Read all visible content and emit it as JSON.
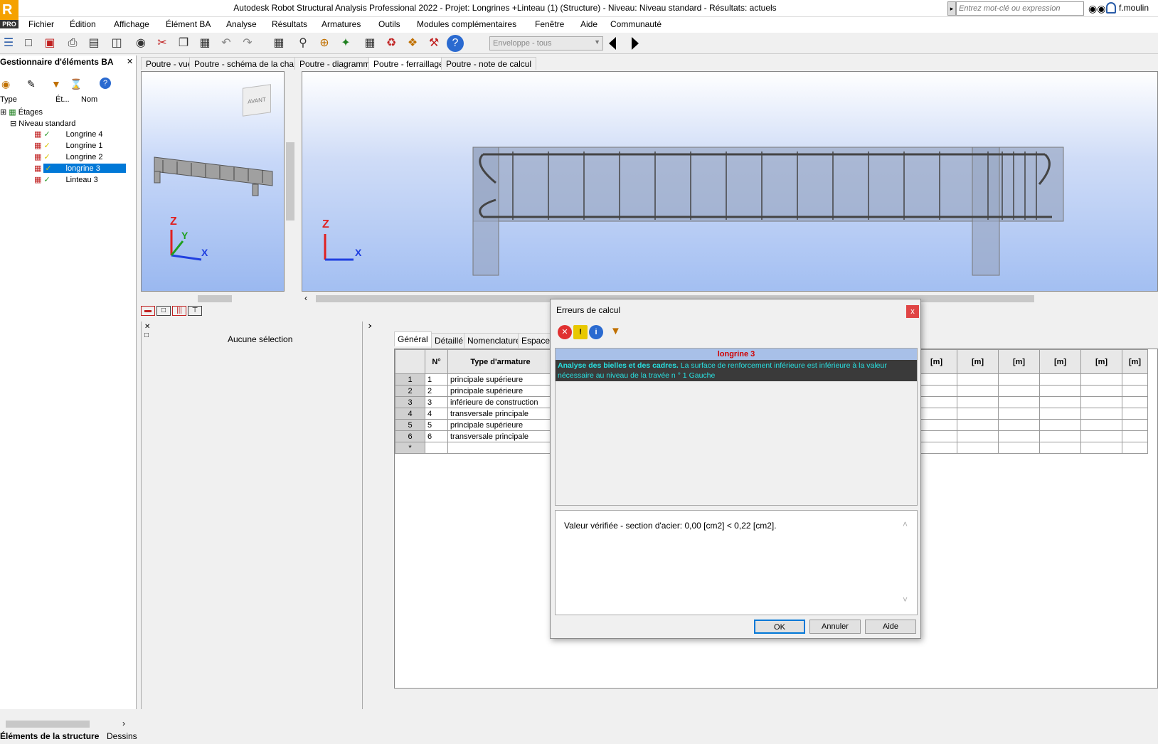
{
  "app": {
    "title": "Autodesk Robot Structural Analysis Professional 2022 - Projet: Longrines +Linteau  (1) (Structure) - Niveau: Niveau standard - Résultats: actuels",
    "logo_letter": "R",
    "logo_sub": "PRO",
    "search_placeholder": "Entrez mot-clé ou expression",
    "user": "f.moulin"
  },
  "menu": [
    "Fichier",
    "Édition",
    "Affichage",
    "Élément BA",
    "Analyse",
    "Résultats",
    "Armatures",
    "Outils",
    "Modules complémentaires",
    "Fenêtre",
    "Aide",
    "Communauté"
  ],
  "toolbar": {
    "envelope_value": "Enveloppe - tous"
  },
  "left_panel": {
    "title": "Gestionnaire d'éléments BA",
    "col_type": "Type",
    "col_state": "Ét...",
    "col_name": "Nom",
    "tree": {
      "root": "Étages",
      "level": "Niveau standard",
      "items": [
        {
          "name": "Longrine 4",
          "status": "ok"
        },
        {
          "name": "Longrine 1",
          "status": "warn"
        },
        {
          "name": "Longrine 2",
          "status": "warn"
        },
        {
          "name": "longrine 3",
          "status": "warn",
          "selected": true
        },
        {
          "name": "Linteau 3",
          "status": "ok"
        }
      ]
    },
    "bottom_tabs": [
      "Éléments de la structure",
      "Dessins"
    ]
  },
  "view_tabs": [
    "Poutre - vue",
    "Poutre - schéma de la charge",
    "Poutre - diagrammes",
    "Poutre - ferraillage",
    "Poutre - note de calcul"
  ],
  "view_tabs_active": 3,
  "view3d": {
    "cube_label": "AVANT",
    "axis_x": "X",
    "axis_y": "Y",
    "axis_z": "Z"
  },
  "selection_panel": {
    "label": "Aucune sélection"
  },
  "grid": {
    "tabs": [
      "Général",
      "Détaillé",
      "Nomenclature",
      "Espacement"
    ],
    "headers": [
      "N°",
      "Type d'armature"
    ],
    "unit_headers": [
      "[m]",
      "[m]",
      "[m]",
      "[m]",
      "[m]",
      "[m]"
    ],
    "rows": [
      {
        "rh": "1",
        "n": "1",
        "type": "principale supérieure"
      },
      {
        "rh": "2",
        "n": "2",
        "type": "principale supérieure"
      },
      {
        "rh": "3",
        "n": "3",
        "type": "inférieure de construction"
      },
      {
        "rh": "4",
        "n": "4",
        "type": "transversale principale"
      },
      {
        "rh": "5",
        "n": "5",
        "type": "principale supérieure"
      },
      {
        "rh": "6",
        "n": "6",
        "type": "transversale principale"
      },
      {
        "rh": "*",
        "n": "",
        "type": ""
      }
    ]
  },
  "dialog": {
    "title": "Erreurs de calcul",
    "close": "x",
    "element": "longrine 3",
    "error_bold": "Analyse des bielles et des cadres.",
    "error_text": " La surface de renforcement inférieure est inférieure à la valeur nécessaire au niveau de la travée n ° 1  Gauche",
    "detail": "Valeur vérifiée - section d'acier: 0,00 [cm2] < 0,22 [cm2].",
    "buttons": {
      "ok": "OK",
      "cancel": "Annuler",
      "help": "Aide"
    }
  }
}
